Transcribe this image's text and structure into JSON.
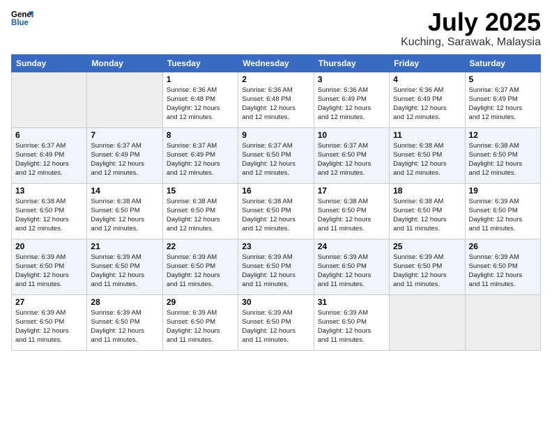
{
  "logo": {
    "line1": "General",
    "line2": "Blue"
  },
  "title": "July 2025",
  "location": "Kuching, Sarawak, Malaysia",
  "days_of_week": [
    "Sunday",
    "Monday",
    "Tuesday",
    "Wednesday",
    "Thursday",
    "Friday",
    "Saturday"
  ],
  "weeks": [
    [
      {
        "day": "",
        "info": ""
      },
      {
        "day": "",
        "info": ""
      },
      {
        "day": "1",
        "info": "Sunrise: 6:36 AM\nSunset: 6:48 PM\nDaylight: 12 hours\nand 12 minutes."
      },
      {
        "day": "2",
        "info": "Sunrise: 6:36 AM\nSunset: 6:48 PM\nDaylight: 12 hours\nand 12 minutes."
      },
      {
        "day": "3",
        "info": "Sunrise: 6:36 AM\nSunset: 6:49 PM\nDaylight: 12 hours\nand 12 minutes."
      },
      {
        "day": "4",
        "info": "Sunrise: 6:36 AM\nSunset: 6:49 PM\nDaylight: 12 hours\nand 12 minutes."
      },
      {
        "day": "5",
        "info": "Sunrise: 6:37 AM\nSunset: 6:49 PM\nDaylight: 12 hours\nand 12 minutes."
      }
    ],
    [
      {
        "day": "6",
        "info": "Sunrise: 6:37 AM\nSunset: 6:49 PM\nDaylight: 12 hours\nand 12 minutes."
      },
      {
        "day": "7",
        "info": "Sunrise: 6:37 AM\nSunset: 6:49 PM\nDaylight: 12 hours\nand 12 minutes."
      },
      {
        "day": "8",
        "info": "Sunrise: 6:37 AM\nSunset: 6:49 PM\nDaylight: 12 hours\nand 12 minutes."
      },
      {
        "day": "9",
        "info": "Sunrise: 6:37 AM\nSunset: 6:50 PM\nDaylight: 12 hours\nand 12 minutes."
      },
      {
        "day": "10",
        "info": "Sunrise: 6:37 AM\nSunset: 6:50 PM\nDaylight: 12 hours\nand 12 minutes."
      },
      {
        "day": "11",
        "info": "Sunrise: 6:38 AM\nSunset: 6:50 PM\nDaylight: 12 hours\nand 12 minutes."
      },
      {
        "day": "12",
        "info": "Sunrise: 6:38 AM\nSunset: 6:50 PM\nDaylight: 12 hours\nand 12 minutes."
      }
    ],
    [
      {
        "day": "13",
        "info": "Sunrise: 6:38 AM\nSunset: 6:50 PM\nDaylight: 12 hours\nand 12 minutes."
      },
      {
        "day": "14",
        "info": "Sunrise: 6:38 AM\nSunset: 6:50 PM\nDaylight: 12 hours\nand 12 minutes."
      },
      {
        "day": "15",
        "info": "Sunrise: 6:38 AM\nSunset: 6:50 PM\nDaylight: 12 hours\nand 12 minutes."
      },
      {
        "day": "16",
        "info": "Sunrise: 6:38 AM\nSunset: 6:50 PM\nDaylight: 12 hours\nand 12 minutes."
      },
      {
        "day": "17",
        "info": "Sunrise: 6:38 AM\nSunset: 6:50 PM\nDaylight: 12 hours\nand 11 minutes."
      },
      {
        "day": "18",
        "info": "Sunrise: 6:38 AM\nSunset: 6:50 PM\nDaylight: 12 hours\nand 11 minutes."
      },
      {
        "day": "19",
        "info": "Sunrise: 6:39 AM\nSunset: 6:50 PM\nDaylight: 12 hours\nand 11 minutes."
      }
    ],
    [
      {
        "day": "20",
        "info": "Sunrise: 6:39 AM\nSunset: 6:50 PM\nDaylight: 12 hours\nand 11 minutes."
      },
      {
        "day": "21",
        "info": "Sunrise: 6:39 AM\nSunset: 6:50 PM\nDaylight: 12 hours\nand 11 minutes."
      },
      {
        "day": "22",
        "info": "Sunrise: 6:39 AM\nSunset: 6:50 PM\nDaylight: 12 hours\nand 11 minutes."
      },
      {
        "day": "23",
        "info": "Sunrise: 6:39 AM\nSunset: 6:50 PM\nDaylight: 12 hours\nand 11 minutes."
      },
      {
        "day": "24",
        "info": "Sunrise: 6:39 AM\nSunset: 6:50 PM\nDaylight: 12 hours\nand 11 minutes."
      },
      {
        "day": "25",
        "info": "Sunrise: 6:39 AM\nSunset: 6:50 PM\nDaylight: 12 hours\nand 11 minutes."
      },
      {
        "day": "26",
        "info": "Sunrise: 6:39 AM\nSunset: 6:50 PM\nDaylight: 12 hours\nand 11 minutes."
      }
    ],
    [
      {
        "day": "27",
        "info": "Sunrise: 6:39 AM\nSunset: 6:50 PM\nDaylight: 12 hours\nand 11 minutes."
      },
      {
        "day": "28",
        "info": "Sunrise: 6:39 AM\nSunset: 6:50 PM\nDaylight: 12 hours\nand 11 minutes."
      },
      {
        "day": "29",
        "info": "Sunrise: 6:39 AM\nSunset: 6:50 PM\nDaylight: 12 hours\nand 11 minutes."
      },
      {
        "day": "30",
        "info": "Sunrise: 6:39 AM\nSunset: 6:50 PM\nDaylight: 12 hours\nand 11 minutes."
      },
      {
        "day": "31",
        "info": "Sunrise: 6:39 AM\nSunset: 6:50 PM\nDaylight: 12 hours\nand 11 minutes."
      },
      {
        "day": "",
        "info": ""
      },
      {
        "day": "",
        "info": ""
      }
    ]
  ]
}
